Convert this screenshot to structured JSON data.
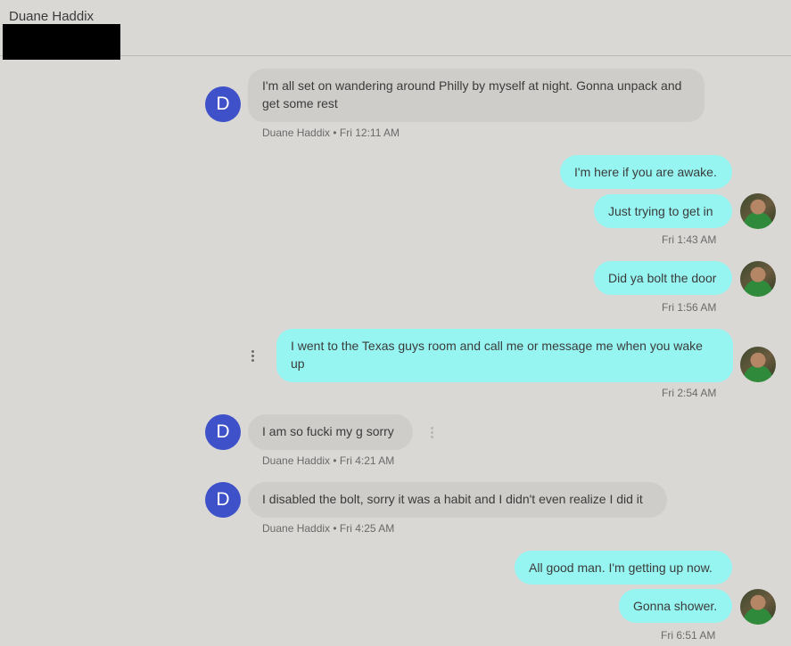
{
  "header": {
    "contact_name": "Duane Haddix"
  },
  "avatars": {
    "contact_initial": "D"
  },
  "messages": [
    {
      "text": "I'm all set on wandering around Philly by myself at night. Gonna unpack and get some rest",
      "meta": "Duane Haddix • Fri 12:11 AM"
    },
    {
      "text": "I'm here if you are awake."
    },
    {
      "text": "Just trying to get in",
      "meta": "Fri 1:43 AM"
    },
    {
      "text": "Did ya bolt the door",
      "meta": "Fri 1:56 AM"
    },
    {
      "text": "I went to the Texas guys room and call me or message me when you wake up",
      "meta": "Fri 2:54 AM"
    },
    {
      "text": "I am so fucki my g sorry",
      "meta": "Duane Haddix • Fri 4:21 AM"
    },
    {
      "text": "I disabled the bolt, sorry it was a habit and I didn't even realize I did it",
      "meta": "Duane Haddix • Fri 4:25 AM"
    },
    {
      "text": "All good man. I'm getting up now."
    },
    {
      "text": "Gonna shower.",
      "meta": "Fri 6:51 AM"
    }
  ],
  "colors": {
    "background": "#dad8d5",
    "incoming_bubble": "#cfcdca",
    "outgoing_bubble": "#97f5f1",
    "avatar": "#3f51c8"
  }
}
